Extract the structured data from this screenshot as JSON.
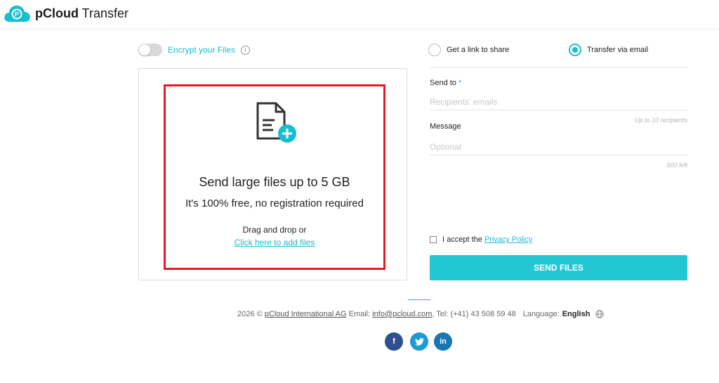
{
  "brand": {
    "bold": "pCloud",
    "rest": " Transfer"
  },
  "encrypt": {
    "label": "Encrypt your Files",
    "enabled": false
  },
  "dropzone": {
    "title": "Send large files up to 5 GB",
    "subtitle": "It's 100% free, no registration required",
    "drag_text": "Drag and drop or",
    "link_text": "Click here to add files"
  },
  "options": {
    "link": {
      "label": "Get a link to share",
      "selected": false
    },
    "email": {
      "label": "Transfer via email",
      "selected": true
    }
  },
  "form": {
    "send_to_label": "Send to",
    "required_mark": "*",
    "recipients_placeholder": "Recipients' emails",
    "recipients_hint": "Up to 10 recipients",
    "message_label": "Message",
    "message_placeholder": "Optional",
    "message_hint": "500 left",
    "accept_text": "I accept the",
    "privacy_link": "Privacy Policy",
    "send_button": "SEND FILES"
  },
  "footer": {
    "year_copy": "2026 ©",
    "company": "pCloud International AG",
    "email_label": "Email:",
    "email": "info@pcloud.com",
    "tel": ", Tel: (+41) 43 508 59 48",
    "language_label": "Language:",
    "language": "English"
  },
  "social": {
    "facebook": "f",
    "twitter": "twitter-icon",
    "linkedin": "in"
  },
  "colors": {
    "accent": "#17bed0",
    "highlight": "#e41b23",
    "button": "#20c8d4"
  }
}
